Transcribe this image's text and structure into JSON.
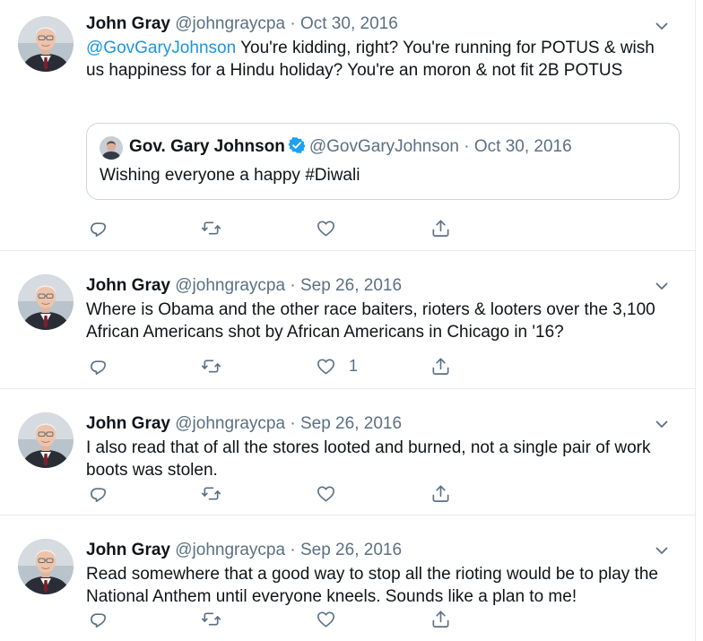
{
  "colors": {
    "link": "#1b95e0",
    "secondary_text": "#5b7083",
    "verified_badge": "#1da1f2",
    "border": "#e6ecf0"
  },
  "icons": {
    "reply": "reply-icon",
    "retweet": "retweet-icon",
    "like": "heart-icon",
    "share": "share-icon",
    "more": "chevron-down-icon",
    "verified": "verified-badge-icon"
  },
  "tweets": [
    {
      "name": "John Gray",
      "handle": "@johngraycpa",
      "separator": "·",
      "date": "Oct 30, 2016",
      "mention": "@GovGaryJohnson",
      "text": " You're kidding, right? You're running for POTUS & wish us happiness for a Hindu holiday? You're an moron & not fit 2B POTUS",
      "quote": {
        "name": "Gov. Gary Johnson",
        "handle": "@GovGaryJohnson",
        "separator": "·",
        "date": "Oct 30, 2016",
        "text": "Wishing everyone a happy #Diwali"
      }
    },
    {
      "name": "John Gray",
      "handle": "@johngraycpa",
      "separator": "·",
      "date": "Sep 26, 2016",
      "text": "Where is Obama and the other race baiters, rioters & looters over the 3,100 African Americans shot by African Americans in Chicago in '16?",
      "like_count": "1"
    },
    {
      "name": "John Gray",
      "handle": "@johngraycpa",
      "separator": "·",
      "date": "Sep 26, 2016",
      "text": "I also read that of all the stores looted and burned, not a single pair of work boots was stolen."
    },
    {
      "name": "John Gray",
      "handle": "@johngraycpa",
      "separator": "·",
      "date": "Sep 26, 2016",
      "text": "Read somewhere that a good way to stop all the rioting would be to play the National Anthem until everyone kneels. Sounds like a plan to me!"
    }
  ]
}
